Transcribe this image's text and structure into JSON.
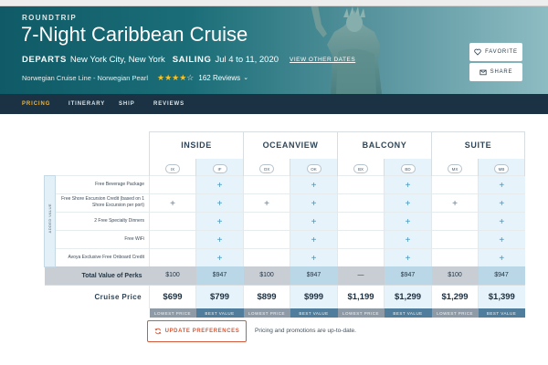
{
  "hero": {
    "kicker": "ROUNDTRIP",
    "title": "7-Night Caribbean Cruise",
    "departs_label": "DEPARTS",
    "departs_value": "New York City, New York",
    "sailing_label": "SAILING",
    "sailing_value": "Jul 4 to 11, 2020",
    "view_other_dates": "VIEW OTHER DATES",
    "cruise_line": "Norwegian Cruise Line - Norwegian Pearl",
    "rating_stars": 3.5,
    "rating_max": 5,
    "reviews": "162 Reviews",
    "favorite_label": "FAVORITE",
    "share_label": "SHARE"
  },
  "nav": {
    "tabs": [
      {
        "label": "PRICING",
        "active": true
      },
      {
        "label": "ITINERARY",
        "active": false
      },
      {
        "label": "SHIP",
        "active": false
      },
      {
        "label": "REVIEWS",
        "active": false
      }
    ]
  },
  "pricing": {
    "categories": [
      "INSIDE",
      "OCEANVIEW",
      "BALCONY",
      "SUITE"
    ],
    "codes": [
      "IX",
      "IF",
      "OX",
      "OK",
      "BX",
      "BD",
      "MX",
      "MB"
    ],
    "added_value_label": "ADDED VALUE",
    "perks": [
      {
        "label": "Free Beverage Package",
        "marks": [
          "",
          "+",
          "",
          "+",
          "",
          "+",
          "",
          "+"
        ]
      },
      {
        "label": "Free Shore Excursion Credit (based on 1 Shore Excursion per port)",
        "marks": [
          "+",
          "+",
          "+",
          "+",
          "",
          "+",
          "+",
          "+"
        ]
      },
      {
        "label": "2 Free Specialty Dinners",
        "marks": [
          "",
          "+",
          "",
          "+",
          "",
          "+",
          "",
          "+"
        ]
      },
      {
        "label": "Free WiFi",
        "marks": [
          "",
          "+",
          "",
          "+",
          "",
          "+",
          "",
          "+"
        ]
      },
      {
        "label": "Avoya Exclusive Free Onboard Credit",
        "marks": [
          "",
          "+",
          "",
          "+",
          "",
          "+",
          "",
          "+"
        ]
      }
    ],
    "total_label": "Total Value of Perks",
    "totals": [
      "$100",
      "$947",
      "$100",
      "$947",
      "—",
      "$947",
      "$100",
      "$947"
    ],
    "cruise_price_label": "Cruise Price",
    "prices": [
      "$699",
      "$799",
      "$899",
      "$999",
      "$1,199",
      "$1,299",
      "$1,299",
      "$1,399"
    ],
    "price_tags": [
      "LOWEST PRICE",
      "BEST VALUE",
      "LOWEST PRICE",
      "BEST VALUE",
      "LOWEST PRICE",
      "BEST VALUE",
      "LOWEST PRICE",
      "BEST VALUE"
    ]
  },
  "footer": {
    "update_label": "UPDATE PREFERENCES",
    "note": "Pricing and promotions are up-to-date."
  },
  "colors": {
    "nav_bg": "#1a3243",
    "nav_active": "#f2b43a",
    "accent_orange": "#d35a3a",
    "selected_col": "#e6f3fa",
    "best_value_bar": "#4f7d9b",
    "lowest_price_bar": "#8e9aa6"
  }
}
